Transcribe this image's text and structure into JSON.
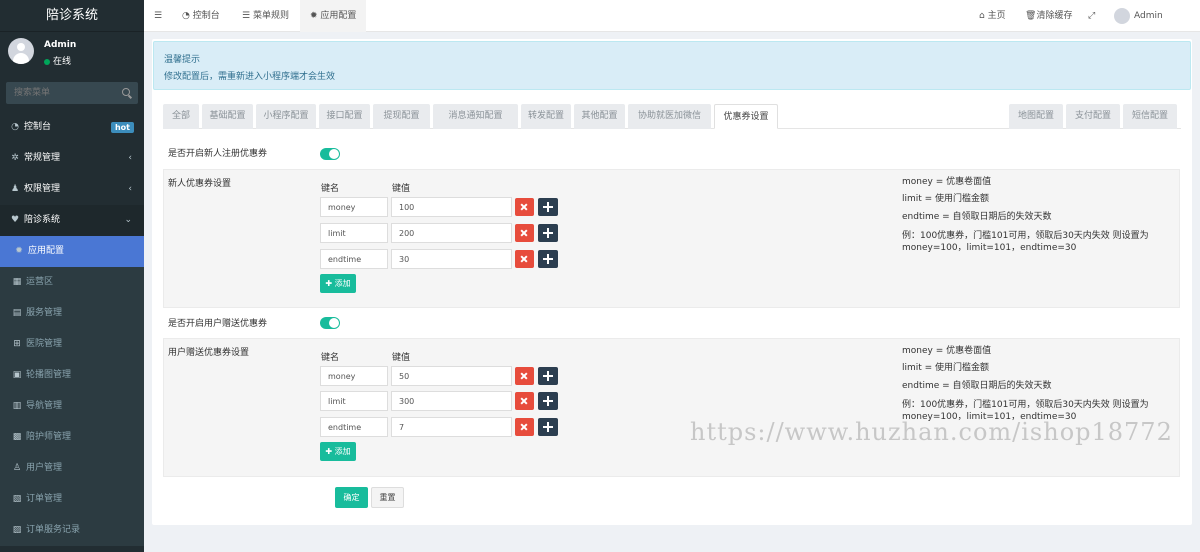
{
  "app": {
    "logo": "陪诊系统"
  },
  "user": {
    "name": "Admin",
    "status": "在线"
  },
  "sidebar": {
    "search_placeholder": "搜索菜单",
    "items": [
      {
        "label": "控制台",
        "icon": "dashboard-icon",
        "badge": "hot"
      },
      {
        "label": "常规管理",
        "icon": "cogs-icon"
      },
      {
        "label": "权限管理",
        "icon": "group-icon"
      },
      {
        "label": "陪诊系统",
        "icon": "heartbeat-icon"
      },
      {
        "label": "应用配置",
        "icon": "gear-icon"
      },
      {
        "label": "运营区",
        "icon": "map-icon"
      },
      {
        "label": "服务管理",
        "icon": "list-icon"
      },
      {
        "label": "医院管理",
        "icon": "hospital-icon"
      },
      {
        "label": "轮播图管理",
        "icon": "image-icon"
      },
      {
        "label": "导航管理",
        "icon": "nav-icon"
      },
      {
        "label": "陪护师管理",
        "icon": "id-card-icon"
      },
      {
        "label": "用户管理",
        "icon": "user-icon"
      },
      {
        "label": "订单管理",
        "icon": "order-icon"
      },
      {
        "label": "订单服务记录",
        "icon": "record-icon"
      }
    ]
  },
  "topbar": {
    "tabs": [
      {
        "label": "控制台"
      },
      {
        "label": "菜单规则"
      },
      {
        "label": "应用配置"
      }
    ],
    "home": "主页",
    "clear_cache": "清除缓存",
    "admin": "Admin"
  },
  "alert": {
    "title": "温馨提示",
    "text": "修改配置后，需重新进入小程序端才会生效"
  },
  "config_tabs": {
    "left": [
      "全部",
      "基础配置",
      "小程序配置",
      "接口配置",
      "提现配置",
      "消息通知配置",
      "转发配置",
      "其他配置",
      "协助就医加微信",
      "优惠券设置"
    ],
    "right": [
      "地图配置",
      "支付配置",
      "短信配置"
    ],
    "active": "优惠券设置"
  },
  "section1": {
    "toggle_label": "是否开启新人注册优惠券",
    "toggle_on": true,
    "panel_title": "新人优惠券设置",
    "key_header": "键名",
    "value_header": "键值",
    "rows": [
      {
        "key": "money",
        "value": "100"
      },
      {
        "key": "limit",
        "value": "200"
      },
      {
        "key": "endtime",
        "value": "30"
      }
    ],
    "add_label": "添加",
    "help": [
      "money = 优惠卷面值",
      "limit = 使用门槛金额",
      "endtime = 自领取日期后的失效天数",
      "例：100优惠券，门槛101可用，领取后30天内失效 则设置为",
      "money=100，limit=101，endtime=30"
    ]
  },
  "section2": {
    "toggle_label": "是否开启用户赠送优惠券",
    "toggle_on": true,
    "panel_title": "用户赠送优惠券设置",
    "key_header": "键名",
    "value_header": "键值",
    "rows": [
      {
        "key": "money",
        "value": "50"
      },
      {
        "key": "limit",
        "value": "300"
      },
      {
        "key": "endtime",
        "value": "7"
      }
    ],
    "add_label": "添加",
    "help": [
      "money = 优惠卷面值",
      "limit = 使用门槛金额",
      "endtime = 自领取日期后的失效天数",
      "例：100优惠券，门槛101可用，领取后30天内失效 则设置为",
      "money=100，limit=101，endtime=30"
    ]
  },
  "actions": {
    "submit": "确定",
    "reset": "重置"
  },
  "watermark": "https://www.huzhan.com/ishop18772"
}
